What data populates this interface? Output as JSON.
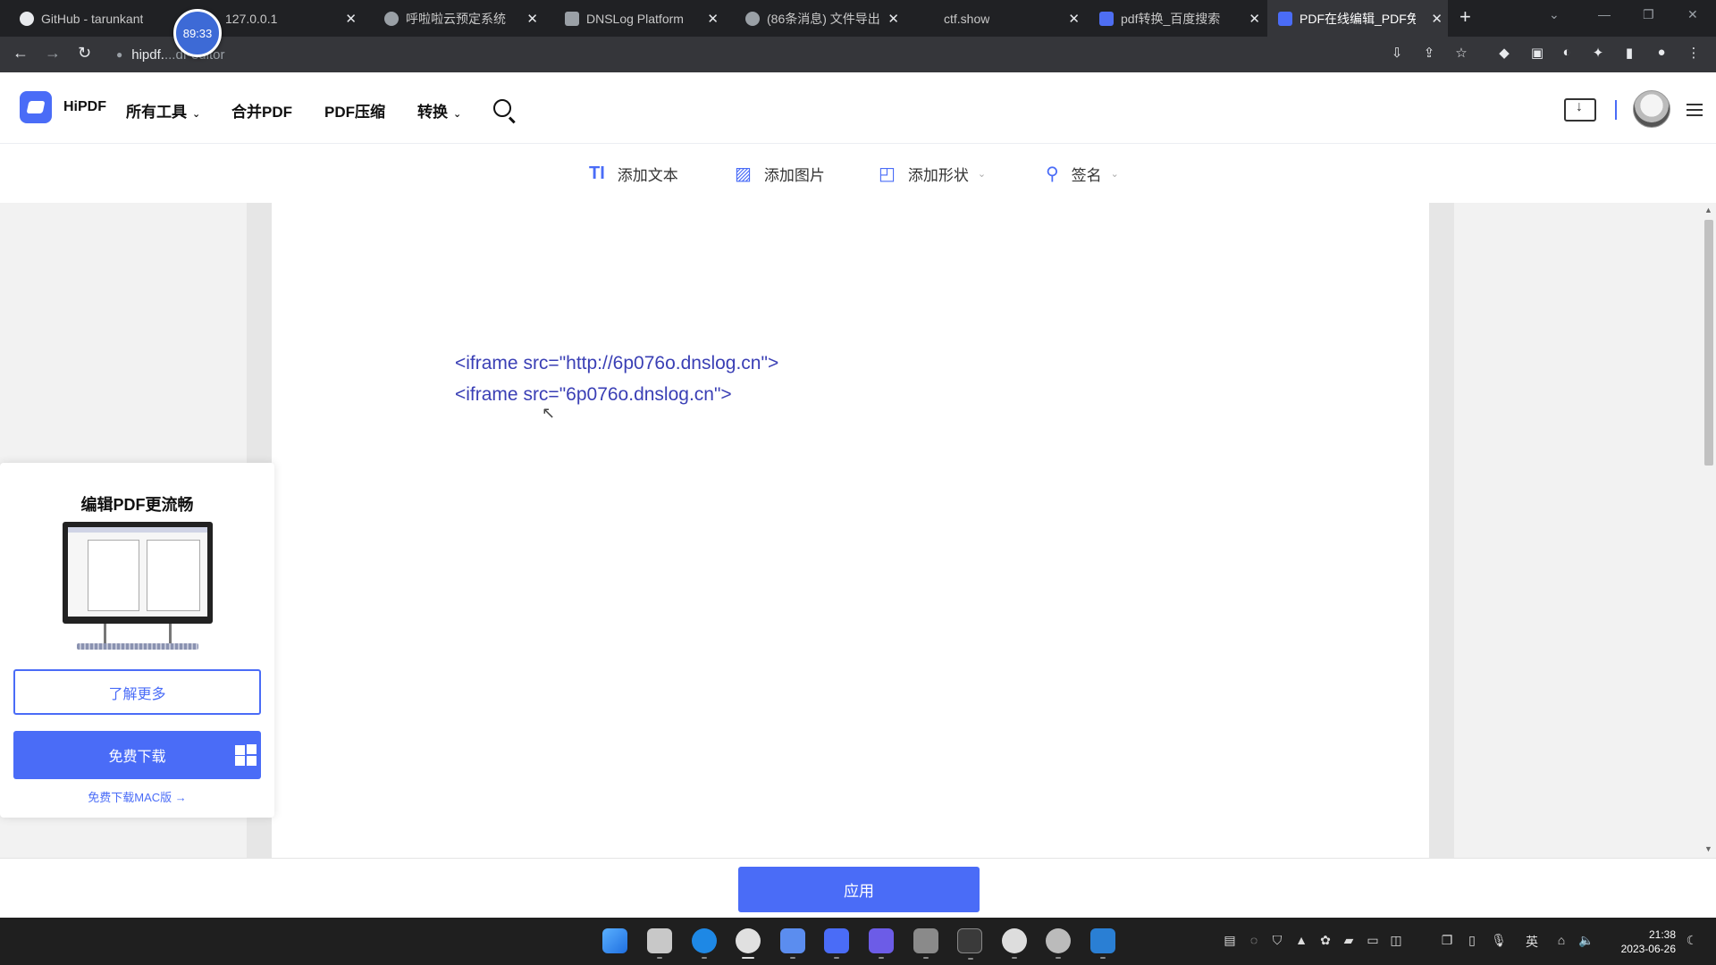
{
  "browser": {
    "tabs": [
      {
        "title": "GitHub - tarunkant"
      },
      {
        "title": "127.0.0.1"
      },
      {
        "title": "呼啦啦云预定系统"
      },
      {
        "title": "DNSLog Platform"
      },
      {
        "title": "(86条消息) 文件导出"
      },
      {
        "title": "ctf.show"
      },
      {
        "title": "pdf转换_百度搜索"
      },
      {
        "title": "PDF在线编辑_PDF免费"
      }
    ],
    "timer_badge": "89:33",
    "address": {
      "host": "hipdf.",
      "path": "...df-editor"
    },
    "close_glyph": "✕",
    "new_tab_glyph": "+"
  },
  "site": {
    "logo": "HiPDF",
    "nav": [
      {
        "label": "所有工具",
        "has_dropdown": true
      },
      {
        "label": "合并PDF",
        "has_dropdown": false
      },
      {
        "label": "PDF压缩",
        "has_dropdown": false
      },
      {
        "label": "转换",
        "has_dropdown": true
      }
    ]
  },
  "tools": [
    {
      "icon": "text-icon",
      "glyph": "TI",
      "label": "添加文本",
      "has_dropdown": false
    },
    {
      "icon": "image-icon",
      "glyph": "▨",
      "label": "添加图片",
      "has_dropdown": false
    },
    {
      "icon": "shape-icon",
      "glyph": "◰",
      "label": "添加形状",
      "has_dropdown": true
    },
    {
      "icon": "signature-icon",
      "glyph": "⚲",
      "label": "签名",
      "has_dropdown": true
    }
  ],
  "pdf_page": {
    "lines": [
      "<iframe src=\"http://6p076o.dnslog.cn\">",
      "<iframe src=\"6p076o.dnslog.cn\">"
    ]
  },
  "promo": {
    "title": "编辑PDF更流畅",
    "learn_more": "了解更多",
    "free_download": "免费下载",
    "mac_link": "免费下载MAC版 →"
  },
  "apply": {
    "label": "应用"
  },
  "taskbar": {
    "time": "21:38",
    "date": "2023-06-26",
    "ime": "英"
  },
  "colors": {
    "accent": "#4a6cf7",
    "text_on_page": "#3a3fb5",
    "chrome_dark": "#202124"
  }
}
